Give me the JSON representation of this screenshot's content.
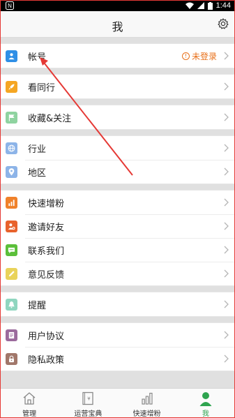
{
  "statusbar": {
    "time": "1:44"
  },
  "header": {
    "title": "我"
  },
  "menu": {
    "account": {
      "label": "帐号",
      "status": "未登录"
    },
    "peers": {
      "label": "看同行"
    },
    "favorites": {
      "label": "收藏&关注"
    },
    "industry": {
      "label": "行业"
    },
    "region": {
      "label": "地区"
    },
    "fast_followers": {
      "label": "快速增粉"
    },
    "invite": {
      "label": "邀请好友"
    },
    "contact": {
      "label": "联系我们"
    },
    "feedback": {
      "label": "意见反馈"
    },
    "reminder": {
      "label": "提醒"
    },
    "agreement": {
      "label": "用户协议"
    },
    "privacy": {
      "label": "隐私政策"
    }
  },
  "tabbar": {
    "manage": "管理",
    "guide": "运营宝典",
    "growth": "快速增粉",
    "me": "我"
  },
  "colors": {
    "accent": "#2ea44f",
    "warning": "#e8701a",
    "annotation": "#e53935"
  }
}
